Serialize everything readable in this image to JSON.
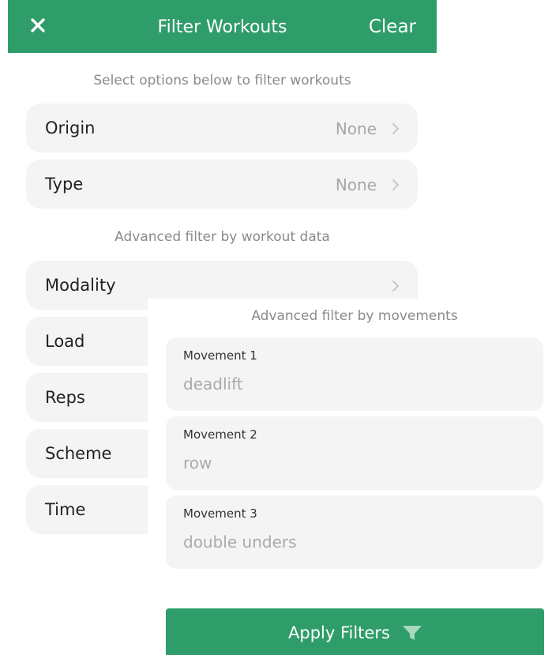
{
  "header": {
    "title": "Filter Workouts",
    "clear_label": "Clear",
    "close_icon": "close-icon"
  },
  "basic": {
    "caption": "Select options below to filter workouts",
    "rows": [
      {
        "label": "Origin",
        "value": "None"
      },
      {
        "label": "Type",
        "value": "None"
      }
    ]
  },
  "advanced": {
    "caption": "Advanced filter by workout data",
    "rows": [
      {
        "label": "Modality",
        "value": ""
      },
      {
        "label": "Load"
      },
      {
        "label": "Reps"
      },
      {
        "label": "Scheme"
      },
      {
        "label": "Time"
      }
    ]
  },
  "movements": {
    "caption": "Advanced filter by movements",
    "items": [
      {
        "label": "Movement 1",
        "placeholder": "deadlift"
      },
      {
        "label": "Movement 2",
        "placeholder": "row"
      },
      {
        "label": "Movement 3",
        "placeholder": "double unders"
      }
    ]
  },
  "apply": {
    "label": "Apply Filters",
    "icon": "filter-icon"
  },
  "colors": {
    "accent": "#2f9d6a",
    "row_bg": "#f4f4f4"
  }
}
